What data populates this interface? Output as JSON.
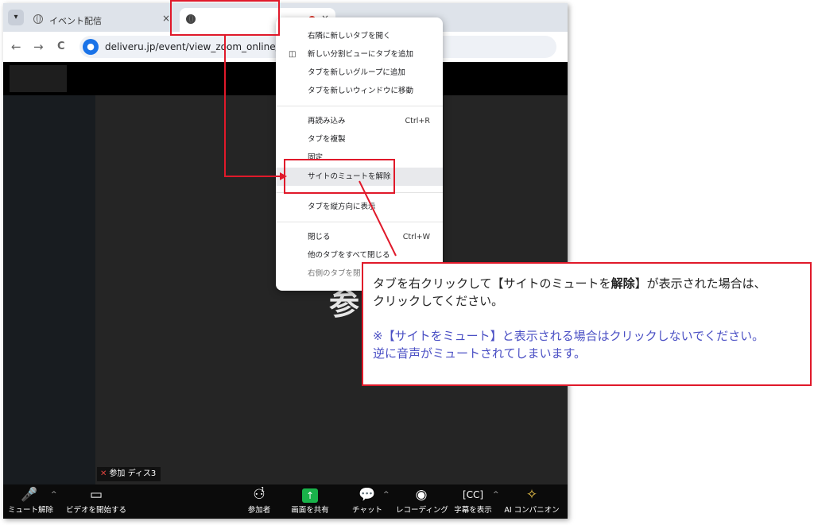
{
  "browser": {
    "tabs": [
      {
        "title": "イベント配信",
        "close": "×"
      },
      {
        "title": "",
        "close": "×"
      }
    ],
    "tab_menu_icon": "chevron-down-icon",
    "nav": {
      "back": "←",
      "forward": "→",
      "reload": "C"
    },
    "url": "deliveru.jp/event/view_zoom_online/"
  },
  "context_menu": {
    "items": [
      {
        "label": "右隣に新しいタブを開く",
        "shortcut": ""
      },
      {
        "label": "新しい分割ビューにタブを追加",
        "shortcut": "",
        "icon": "split-view-icon"
      },
      {
        "label": "タブを新しいグループに追加",
        "shortcut": ""
      },
      {
        "label": "タブを新しいウィンドウに移動",
        "shortcut": ""
      },
      {
        "label": "再読み込み",
        "shortcut": "Ctrl+R"
      },
      {
        "label": "タブを複製",
        "shortcut": ""
      },
      {
        "label": "固定",
        "shortcut": ""
      },
      {
        "label": "サイトのミュートを解除",
        "shortcut": ""
      },
      {
        "label": "タブを縦方向に表示",
        "shortcut": ""
      },
      {
        "label": "閉じる",
        "shortcut": "Ctrl+W"
      },
      {
        "label": "他のタブをすべて閉じる",
        "shortcut": ""
      },
      {
        "label": "右側のタブを閉じる",
        "shortcut": ""
      }
    ]
  },
  "video": {
    "big_text": "参",
    "participant_tag": "参加 ディス3"
  },
  "zoom_toolbar": {
    "mute": "ミュート解除",
    "video": "ビデオを開始する",
    "participants": "参加者",
    "participants_count": "1",
    "share": "画面を共有",
    "chat": "チャット",
    "record": "レコーディング",
    "captions": "字幕を表示",
    "ai": "AI コンパニオン"
  },
  "callout": {
    "line1_a": "タブを右クリックして【サイトのミュートを",
    "line1_bold": "解除",
    "line1_b": "】が表示された場合は、",
    "line1_c": "クリックしてください。",
    "line2_a": "※【サイトをミュート】と表示される場合はクリックしないでください。",
    "line2_b": "逆に音声がミュートされてしまいます。"
  },
  "colors": {
    "annotation_red": "#e0192a",
    "note_blue": "#4a4fc4",
    "share_green": "#19b34a"
  }
}
